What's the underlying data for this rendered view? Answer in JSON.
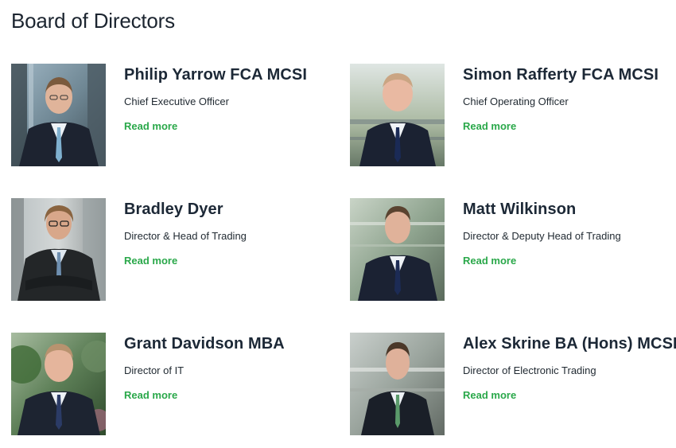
{
  "page": {
    "title": "Board of Directors"
  },
  "colors": {
    "link": "#2aa84a",
    "heading": "#1c2836"
  },
  "directors": [
    {
      "name": "Philip Yarrow FCA MCSI",
      "role": "Chief Executive Officer",
      "link_label": "Read more",
      "photo": "portrait-philip-yarrow"
    },
    {
      "name": "Simon Rafferty FCA MCSI",
      "role": "Chief Operating Officer",
      "link_label": "Read more",
      "photo": "portrait-simon-rafferty"
    },
    {
      "name": "Bradley Dyer",
      "role": "Director & Head of Trading",
      "link_label": "Read more",
      "photo": "portrait-bradley-dyer"
    },
    {
      "name": "Matt Wilkinson",
      "role": "Director & Deputy Head of Trading",
      "link_label": "Read more",
      "photo": "portrait-matt-wilkinson"
    },
    {
      "name": "Grant Davidson MBA",
      "role": "Director of IT",
      "link_label": "Read more",
      "photo": "portrait-grant-davidson"
    },
    {
      "name": "Alex Skrine BA (Hons) MCSI",
      "role": "Director of Electronic Trading",
      "link_label": "Read more",
      "photo": "portrait-alex-skrine"
    }
  ]
}
